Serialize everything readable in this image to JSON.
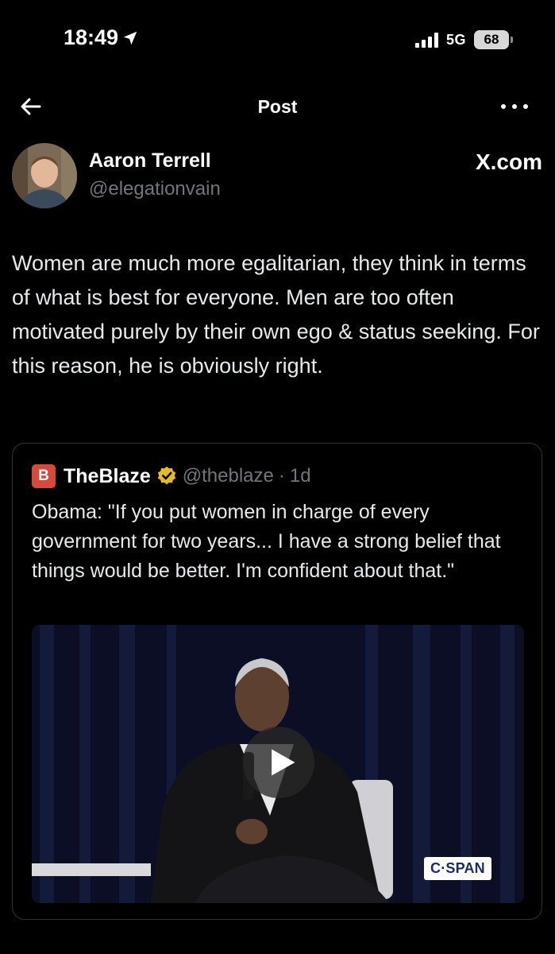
{
  "status": {
    "time": "18:49",
    "network": "5G",
    "battery": "68"
  },
  "nav": {
    "title": "Post"
  },
  "post": {
    "author": {
      "name": "Aaron Terrell",
      "handle": "@elegationvain"
    },
    "site": "X.com",
    "text": "Women are much more egalitarian, they think in terms of what is best for everyone. Men are too often motivated purely by their own ego & status seeking. For this reason, he is obviously right."
  },
  "quote": {
    "name": "TheBlaze",
    "handle": "@theblaze",
    "separator": "·",
    "time": "1d",
    "text": "Obama: \"If you put women in charge of every government for two years... I have a strong belief that things would be better. I'm confident about that.\"",
    "video_badge": "C·SPAN"
  },
  "colors": {
    "background": "#000000",
    "text": "#e7e9ea",
    "secondary": "#71767b",
    "border": "#2f3336",
    "verified": "#e8b923",
    "blaze": "#d44a3d"
  },
  "icons": [
    "location-arrow-icon",
    "signal-icon",
    "battery-icon",
    "back-arrow-icon",
    "more-icon",
    "verified-badge-icon",
    "play-icon"
  ]
}
